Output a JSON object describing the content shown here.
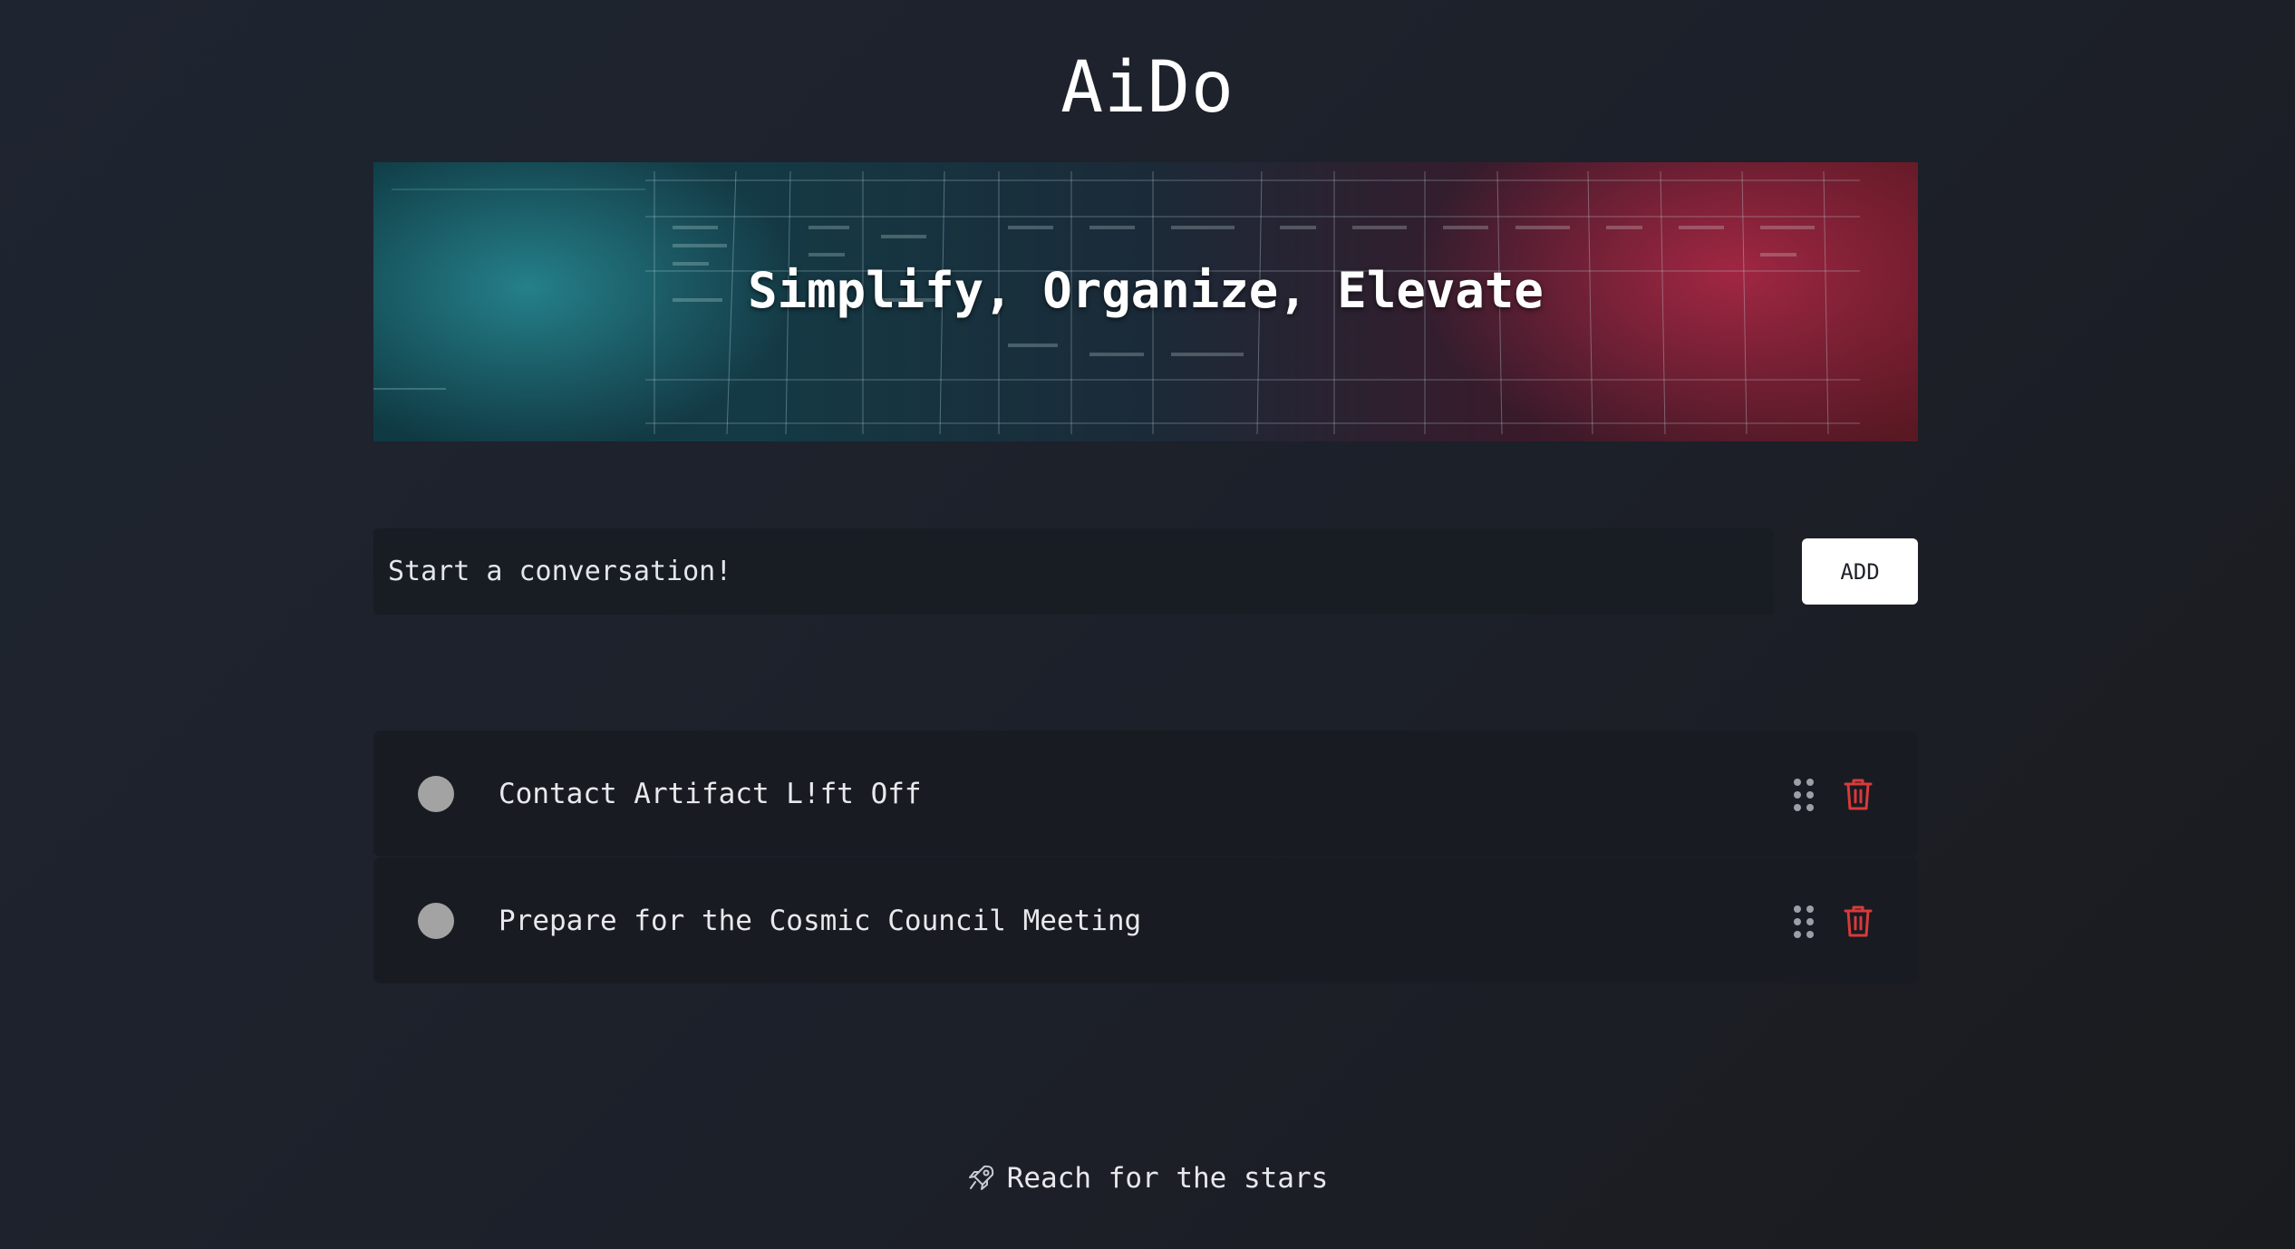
{
  "app": {
    "title": "AiDo"
  },
  "banner": {
    "tagline": "Simplify, Organize, Elevate"
  },
  "composer": {
    "placeholder": "Start a conversation!",
    "value": "",
    "add_label": "ADD"
  },
  "tasks": [
    {
      "label": "Contact Artifact L!ft Off",
      "completed": false
    },
    {
      "label": "Prepare for the Cosmic Council Meeting",
      "completed": false
    }
  ],
  "footer": {
    "text": "Reach for the stars",
    "icon": "rocket-icon"
  },
  "colors": {
    "background": "#1f2530",
    "delete_accent": "#d93a3a",
    "checkbox": "#a3a3a3",
    "row_background": "#181b21"
  }
}
